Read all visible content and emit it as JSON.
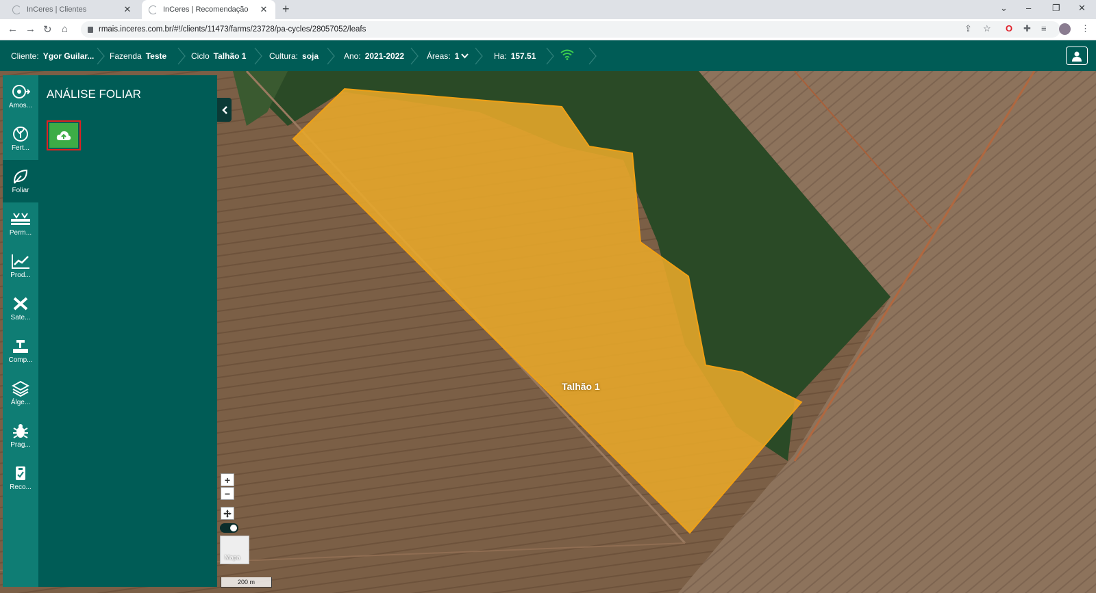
{
  "browser": {
    "tabs": [
      {
        "title": "InCeres | Clientes",
        "close": "✕"
      },
      {
        "title": "InCeres | Recomendação",
        "close": "✕"
      }
    ],
    "new_tab": "+",
    "url": "rmais.inceres.com.br/#!/clients/11473/farms/23728/pa-cycles/28057052/leafs",
    "nav": {
      "back": "←",
      "forward": "→",
      "reload": "↻",
      "home": "⌂"
    },
    "window": {
      "dropdown": "⌄",
      "minimize": "–",
      "restore": "❐",
      "close": "✕"
    }
  },
  "header": {
    "cliente_label": "Cliente:",
    "cliente_value": "Ygor Guilar...",
    "fazenda_label": "Fazenda",
    "fazenda_value": "Teste",
    "ciclo_label": "Ciclo",
    "ciclo_value": "Talhão 1",
    "cultura_label": "Cultura:",
    "cultura_value": "soja",
    "ano_label": "Ano:",
    "ano_value": "2021-2022",
    "areas_label": "Áreas:",
    "areas_value": "1",
    "ha_label": "Ha:",
    "ha_value": "157.51",
    "wifi_color": "#3ccf4e"
  },
  "sidebar": {
    "items": [
      {
        "label": "Amos...",
        "icon": "sampling-icon"
      },
      {
        "label": "Fert...",
        "icon": "fertility-icon"
      },
      {
        "label": "Foliar",
        "icon": "leaf-icon"
      },
      {
        "label": "Perm...",
        "icon": "permanent-crop-icon"
      },
      {
        "label": "Prod...",
        "icon": "productivity-chart-icon"
      },
      {
        "label": "Sate...",
        "icon": "satellite-icon"
      },
      {
        "label": "Comp...",
        "icon": "compaction-icon"
      },
      {
        "label": "Álge...",
        "icon": "layers-icon"
      },
      {
        "label": "Prag...",
        "icon": "bug-icon"
      },
      {
        "label": "Reco...",
        "icon": "recommendation-icon"
      }
    ],
    "active_index": 2
  },
  "panel": {
    "title": "ANÁLISE FOLIAR",
    "upload_button_color": "#3dac46",
    "highlight_color": "#e02020"
  },
  "map": {
    "plot_label": "Talhão 1",
    "plot_fill": "#e8a82a",
    "zoom_in": "+",
    "zoom_out": "−",
    "basemap_label": "Mapa",
    "scale_label": "200 m"
  }
}
